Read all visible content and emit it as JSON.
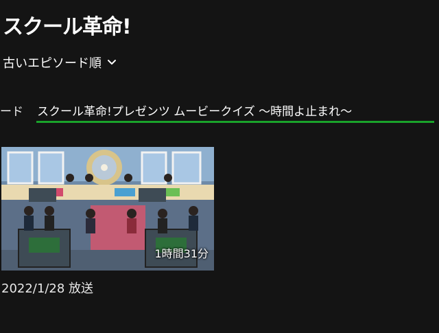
{
  "show": {
    "title": "スクール革命!"
  },
  "sort": {
    "label": "古いエピソード順"
  },
  "tabs": {
    "prev_label": "ード",
    "active_label": "スクール革命!プレゼンツ ムービークイズ 〜時間よ止まれ〜"
  },
  "episode": {
    "duration": "1時間31分",
    "airdate": "2022/1/28 放送"
  },
  "colors": {
    "accent": "#1aa32a",
    "background": "#141414"
  },
  "icons": {
    "sort": "chevron-down-icon"
  }
}
